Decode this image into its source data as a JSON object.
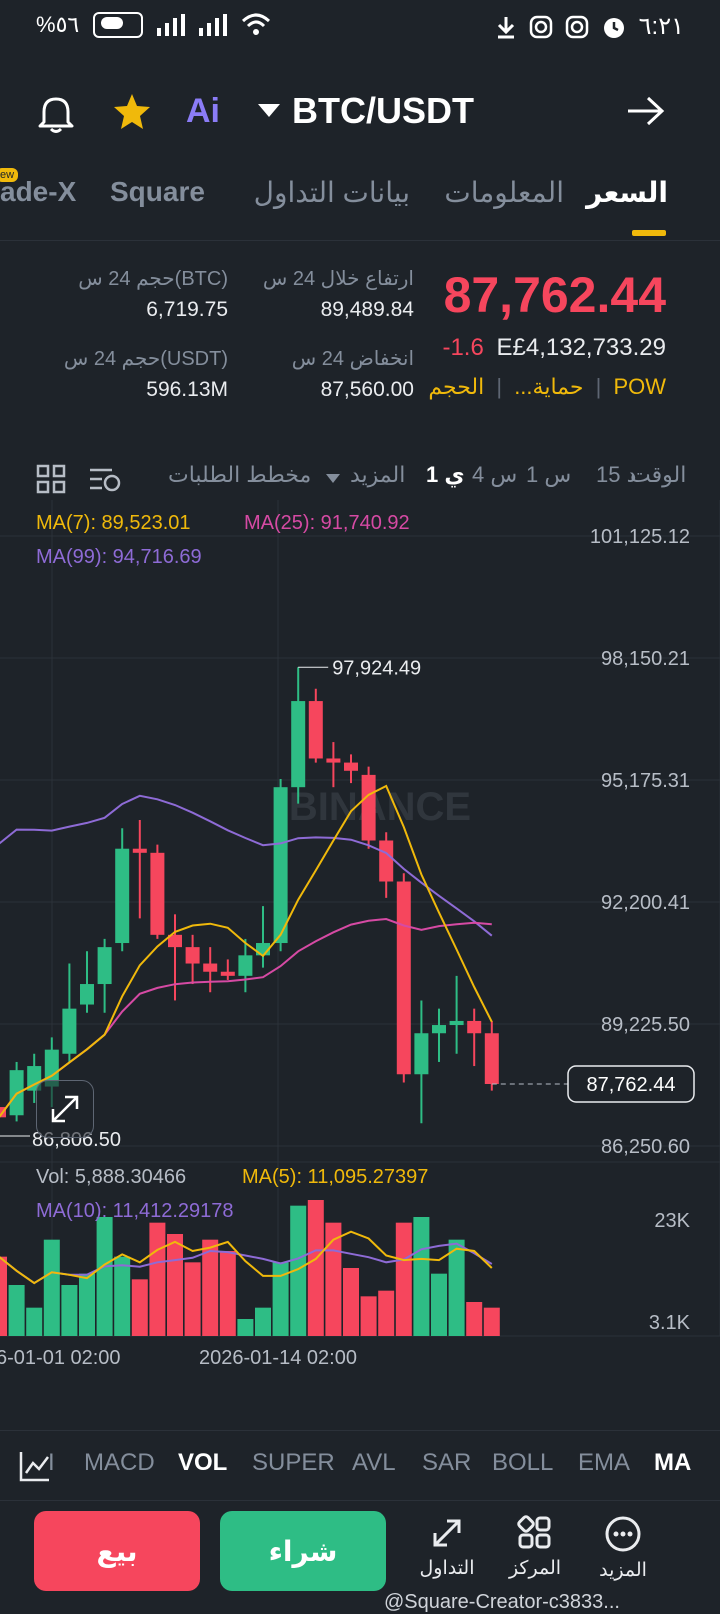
{
  "status_bar": {
    "battery": "%٥٦",
    "time": "٦:٢١"
  },
  "header": {
    "pair": "BTC/USDT",
    "ai_label": "Ai"
  },
  "tabs": [
    {
      "label": "السعر",
      "active": true
    },
    {
      "label": "المعلومات"
    },
    {
      "label": "بيانات التداول"
    },
    {
      "label": "Square"
    },
    {
      "label": "ade-X"
    }
  ],
  "tab_badge": "ew",
  "ticker": {
    "price": "87,762.44",
    "change": "-1.6",
    "fiat": "E£4,132,733.29",
    "tags": [
      "POW",
      "الحجم",
      "حماية..."
    ],
    "high_label": "ارتفاع خلال 24 س",
    "high_value": "89,489.84",
    "low_label": "انخفاض 24 س",
    "low_value": "87,560.00",
    "vol_btc_label": "حجم 24 س(BTC)",
    "vol_btc_value": "6,719.75",
    "vol_usdt_label": "حجم 24 س(USDT)",
    "vol_usdt_value": "596.13M"
  },
  "timeframes": {
    "time_label": "الوقت",
    "items": [
      "15 د",
      "1 س",
      "4 س",
      "1 ي"
    ],
    "active": "1 ي",
    "more": "المزيد",
    "depth": "مخطط الطلبات"
  },
  "ma_legend": {
    "ma7": "MA(7): 89,523.01",
    "ma25": "MA(25): 91,740.92",
    "ma99": "MA(99): 94,716.69"
  },
  "chart_data": {
    "type": "candlestick",
    "y_ticks": [
      "101,125.12",
      "98,150.21",
      "95,175.31",
      "92,200.41",
      "89,225.50",
      "86,250.60"
    ],
    "ylim": [
      86250.6,
      101125.12
    ],
    "current_price": "87,762.44",
    "high_marker": "97,924.49",
    "low_marker": "86,806.50",
    "watermark": "BINANCE",
    "candles": [
      {
        "o": 87200,
        "h": 88700,
        "l": 86900,
        "c": 86950
      },
      {
        "o": 87000,
        "h": 88300,
        "l": 86850,
        "c": 88100
      },
      {
        "o": 87600,
        "h": 88500,
        "l": 87300,
        "c": 88200
      },
      {
        "o": 87700,
        "h": 88900,
        "l": 87200,
        "c": 88600
      },
      {
        "o": 88500,
        "h": 90700,
        "l": 88300,
        "c": 89600
      },
      {
        "o": 89700,
        "h": 91000,
        "l": 89500,
        "c": 90200
      },
      {
        "o": 90200,
        "h": 91300,
        "l": 89500,
        "c": 91100
      },
      {
        "o": 91200,
        "h": 94000,
        "l": 91000,
        "c": 93500
      },
      {
        "o": 93500,
        "h": 94200,
        "l": 91800,
        "c": 93400
      },
      {
        "o": 93400,
        "h": 93600,
        "l": 91300,
        "c": 91400
      },
      {
        "o": 91400,
        "h": 91900,
        "l": 89800,
        "c": 91100
      },
      {
        "o": 91100,
        "h": 91400,
        "l": 90200,
        "c": 90700
      },
      {
        "o": 90700,
        "h": 91100,
        "l": 90000,
        "c": 90500
      },
      {
        "o": 90500,
        "h": 90800,
        "l": 90300,
        "c": 90400
      },
      {
        "o": 90400,
        "h": 91300,
        "l": 90000,
        "c": 90900
      },
      {
        "o": 90900,
        "h": 92100,
        "l": 90600,
        "c": 91200
      },
      {
        "o": 91200,
        "h": 95200,
        "l": 91000,
        "c": 95000
      },
      {
        "o": 95000,
        "h": 97924.49,
        "l": 94600,
        "c": 97100
      },
      {
        "o": 97100,
        "h": 97400,
        "l": 95600,
        "c": 95700
      },
      {
        "o": 95700,
        "h": 96100,
        "l": 95000,
        "c": 95600
      },
      {
        "o": 95600,
        "h": 95800,
        "l": 95100,
        "c": 95400
      },
      {
        "o": 95300,
        "h": 95500,
        "l": 93500,
        "c": 93700
      },
      {
        "o": 93700,
        "h": 93900,
        "l": 92300,
        "c": 92700
      },
      {
        "o": 92700,
        "h": 92900,
        "l": 87800,
        "c": 88000
      },
      {
        "o": 88000,
        "h": 89800,
        "l": 86806.5,
        "c": 89000
      },
      {
        "o": 89000,
        "h": 89600,
        "l": 88300,
        "c": 89200
      },
      {
        "o": 89200,
        "h": 90400,
        "l": 88500,
        "c": 89300
      },
      {
        "o": 89300,
        "h": 89600,
        "l": 88200,
        "c": 89000
      },
      {
        "o": 89000,
        "h": 89300,
        "l": 87600,
        "c": 87762.44
      }
    ],
    "volume": {
      "legend_vol": "Vol: 5,888.30466",
      "legend_ma5": "MA(5): 11,095.27397",
      "legend_ma10": "MA(10): 11,412.29178",
      "y_ticks": [
        "23K",
        "3.1K"
      ],
      "values": [
        14,
        9,
        5,
        17,
        9,
        11,
        21,
        14,
        10,
        20,
        18,
        13,
        17,
        15,
        3,
        5,
        13,
        23,
        24,
        20,
        12,
        7,
        8,
        20,
        21,
        11,
        17,
        6,
        5
      ]
    },
    "x_labels": [
      "6-01-01 02:00",
      "2026-01-14 02:00"
    ]
  },
  "indicators": {
    "items": [
      "MA",
      "EMA",
      "BOLL",
      "SAR",
      "AVL",
      "SUPER",
      "VOL",
      "MACD",
      "I"
    ],
    "active": [
      "MA",
      "VOL"
    ]
  },
  "bottom": {
    "sell": "بيع",
    "buy": "شراء",
    "more": "المزيد",
    "center": "المركز",
    "trade": "التداول",
    "watermark": "@Square-Creator-c3833..."
  },
  "colors": {
    "up": "#2ebd85",
    "down": "#f6465d",
    "ma7": "#f0b90b",
    "ma25": "#d64aa4",
    "ma99": "#8e6bd6",
    "accent": "#f0b90b"
  }
}
